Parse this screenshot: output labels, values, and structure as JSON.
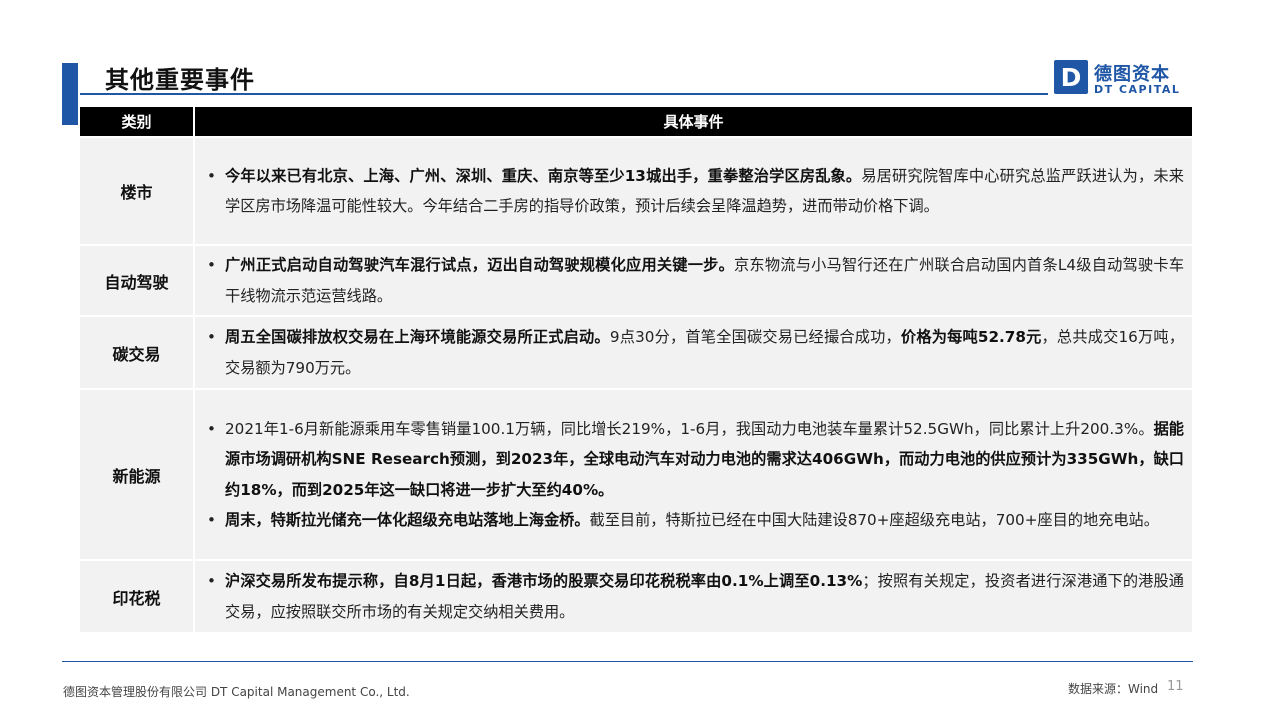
{
  "header": {
    "title": "其他重要事件"
  },
  "logo": {
    "mark": "D",
    "name_cn": "德图资本",
    "name_en": "DT CAPITAL"
  },
  "table": {
    "headers": [
      "类别",
      "具体事件"
    ],
    "rows": [
      {
        "category": "楼市",
        "bullets": [
          {
            "bold": "今年以来已有北京、上海、广州、深圳、重庆、南京等至少13城出手，重拳整治学区房乱象。",
            "normal": "易居研究院智库中心研究总监严跃进认为，未来学区房市场降温可能性较大。今年结合二手房的指导价政策，预计后续会呈降温趋势，进而带动价格下调。"
          }
        ]
      },
      {
        "category": "自动驾驶",
        "bullets": [
          {
            "bold": "广州正式启动自动驾驶汽车混行试点，迈出自动驾驶规模化应用关键一步。",
            "normal": "京东物流与小马智行还在广州联合启动国内首条L4级自动驾驶卡车干线物流示范运营线路。"
          }
        ]
      },
      {
        "category": "碳交易",
        "bullets": [
          {
            "bold": "周五全国碳排放权交易在上海环境能源交易所正式启动。",
            "normal": "9点30分，首笔全国碳交易已经撮合成功，",
            "bold2": "价格为每吨52.78元",
            "normal2": "，总共成交16万吨，交易额为790万元。"
          }
        ]
      },
      {
        "category": "新能源",
        "bullets": [
          {
            "normal": "2021年1-6月新能源乘用车零售销量100.1万辆，同比增长219%，1-6月，我国动力电池装车量累计52.5GWh，同比累计上升200.3%。",
            "bold": "据能源市场调研机构SNE Research预测，到2023年，全球电动汽车对动力电池的需求达406GWh，而动力电池的供应预计为335GWh，缺口约18%，而到2025年这一缺口将进一步扩大至约40%。"
          },
          {
            "bold": "周末，特斯拉光储充一体化超级充电站落地上海金桥。",
            "normal": "截至目前，特斯拉已经在中国大陆建设870+座超级充电站，700+座目的地充电站。"
          }
        ]
      },
      {
        "category": "印花税",
        "bullets": [
          {
            "bold": "沪深交易所发布提示称，自8月1日起，香港市场的股票交易印花税税率由0.1%上调至0.13%",
            "normal": "；按照有关规定，投资者进行深港通下的港股通交易，应按照联交所市场的有关规定交纳相关费用。"
          }
        ]
      }
    ]
  },
  "footer": {
    "company": "德图资本管理股份有限公司  DT Capital  Management  Co., Ltd.",
    "source": "数据来源：Wind",
    "page": "11"
  },
  "colors": {
    "brand_blue": "#1f56a6",
    "header_bg": "#000000",
    "row_bg": "#f2f2f2"
  }
}
